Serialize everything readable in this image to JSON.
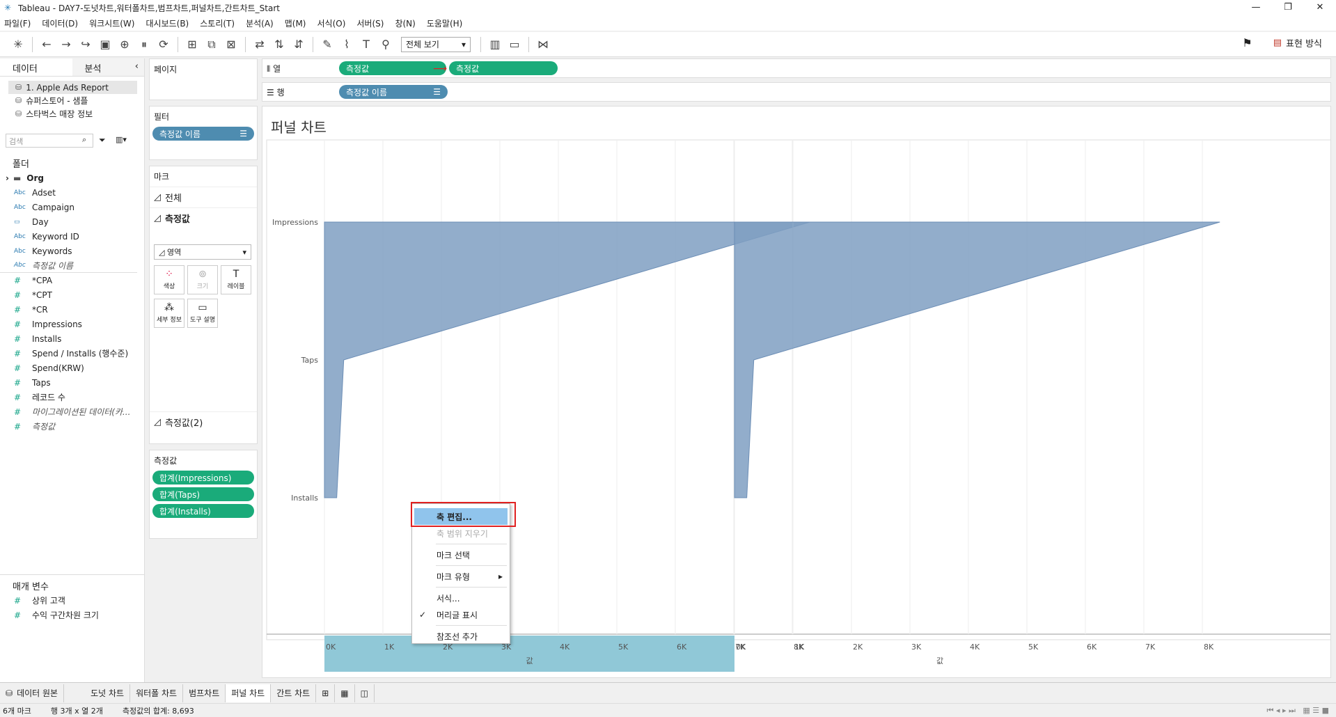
{
  "window": {
    "title": "Tableau - DAY7-도넛차트,워터폴차트,범프차트,퍼널차트,간트차트_Start",
    "controls": [
      "—",
      "❐",
      "✕"
    ]
  },
  "menu": [
    "파일(F)",
    "데이터(D)",
    "워크시트(W)",
    "대시보드(B)",
    "스토리(T)",
    "분석(A)",
    "맵(M)",
    "서식(O)",
    "서버(S)",
    "창(N)",
    "도움말(H)"
  ],
  "toolbar": {
    "view_select": "전체 보기",
    "present_label": "표현 방식"
  },
  "data_pane": {
    "tab_data": "데이터",
    "tab_analysis": "분석",
    "datasources": [
      "1. Apple Ads Report",
      "슈퍼스토어 - 샘플",
      "스타벅스 매장 정보"
    ],
    "search_placeholder": "검색",
    "folders_label": "폴더",
    "folder_org": "Org",
    "dimensions": [
      {
        "type": "Abc",
        "name": "Adset"
      },
      {
        "type": "Abc",
        "name": "Campaign"
      },
      {
        "type": "date",
        "name": "Day"
      },
      {
        "type": "Abc",
        "name": "Keyword ID"
      },
      {
        "type": "Abc",
        "name": "Keywords"
      },
      {
        "type": "Abc",
        "name": "측정값 이름"
      }
    ],
    "measures": [
      "*CPA",
      "*CPT",
      "*CR",
      "Impressions",
      "Installs",
      "Spend / Installs (행수준)",
      "Spend(KRW)",
      "Taps",
      "레코드 수",
      "마이그레이션된 데이터(카...",
      "측정값"
    ],
    "params_label": "매개 변수",
    "params": [
      "상위 고객",
      "수익 구간차원 크기"
    ]
  },
  "shelves": {
    "pages": "페이지",
    "filters": "필터",
    "filter_pill": "측정값 이름",
    "marks": "마크",
    "marks_all": "전체",
    "marks_measure": "측정값",
    "mark_type": "영역",
    "mark_buttons": [
      "색상",
      "크기",
      "레이블",
      "세부 정보",
      "도구 설명"
    ],
    "marks_measure2": "측정값(2)",
    "measure_values_label": "측정값",
    "measure_values": [
      "합계(Impressions)",
      "합계(Taps)",
      "합계(Installs)"
    ],
    "columns_label": "열",
    "columns_pills": [
      "측정값",
      "측정값"
    ],
    "rows_label": "행",
    "rows_pill": "측정값 이름"
  },
  "view": {
    "title": "퍼널 차트",
    "axis_title": "값",
    "context_menu": [
      {
        "label": "축 편집...",
        "state": "highlight"
      },
      {
        "label": "축 범위 지우기",
        "state": "disabled"
      },
      {
        "label": "마크 선택",
        "state": "normal"
      },
      {
        "label": "마크 유형",
        "state": "submenu"
      },
      {
        "label": "서식...",
        "state": "normal"
      },
      {
        "label": "머리글 표시",
        "state": "checked"
      },
      {
        "label": "참조선 추가",
        "state": "normal"
      }
    ]
  },
  "chart_data": {
    "type": "area",
    "categories": [
      "Impressions",
      "Taps",
      "Installs"
    ],
    "x_ticks": [
      "0K",
      "1K",
      "2K",
      "3K",
      "4K",
      "5K",
      "6K",
      "7K",
      "8K"
    ],
    "xlim": [
      0,
      8400
    ],
    "xlabel": "값",
    "series": [
      {
        "values": [
          8300,
          330,
          210
        ]
      },
      {
        "values": [
          8300,
          330,
          210
        ]
      }
    ],
    "color": "#7f9fc2"
  },
  "sheets": [
    "데이터 원본",
    "도넛 차트",
    "워터폴 차트",
    "범프차트",
    "퍼널 차트",
    "간트 차트"
  ],
  "active_sheet": "퍼널 차트",
  "status": {
    "marks": "6개 마크",
    "dims": "행 3개 x 열 2개",
    "sum": "측정값의 합계: 8,693"
  }
}
